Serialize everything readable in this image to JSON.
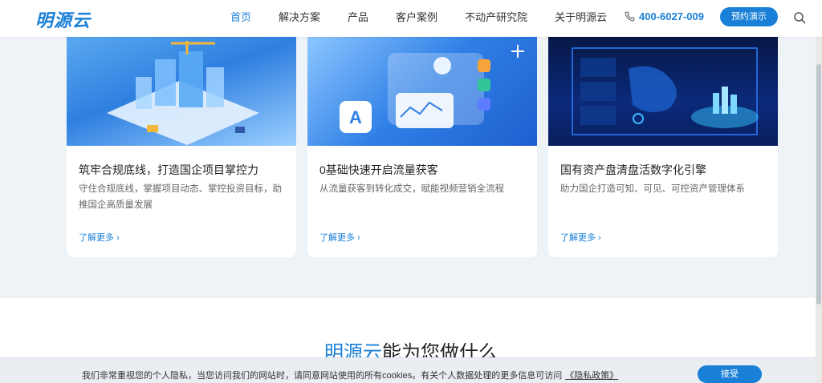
{
  "header": {
    "logo": "明源云",
    "nav": [
      "首页",
      "解决方案",
      "产品",
      "客户案例",
      "不动产研究院",
      "关于明源云"
    ],
    "active_index": 0,
    "phone": "400-6027-009",
    "demo_button": "预约演示"
  },
  "cards": [
    {
      "title": "筑牢合规底线，打造国企项目掌控力",
      "desc": "守住合规底线，掌握项目动态、掌控投资目标，助推国企高质量发展",
      "more": "了解更多 ›"
    },
    {
      "title": "0基础快速开启流量获客",
      "desc": "从流量获客到转化成交，赋能视频营销全流程",
      "more": "了解更多 ›"
    },
    {
      "title": "国有资产盘清盘活数字化引擎",
      "desc": "助力国企打造可知、可见、可控资产管理体系",
      "more": "了解更多 ›"
    }
  ],
  "section": {
    "title_brand": "明源云",
    "title_rest": "能为您做什么"
  },
  "cookie": {
    "text": "我们非常重视您的个人隐私，当您访问我们的网站时，请同意网站使用的所有cookies。有关个人数据处理的更多信息可访问",
    "link": "《隐私政策》",
    "accept": "接受"
  },
  "colors": {
    "accent": "#1a7fd6",
    "background": "#eef3f7"
  }
}
